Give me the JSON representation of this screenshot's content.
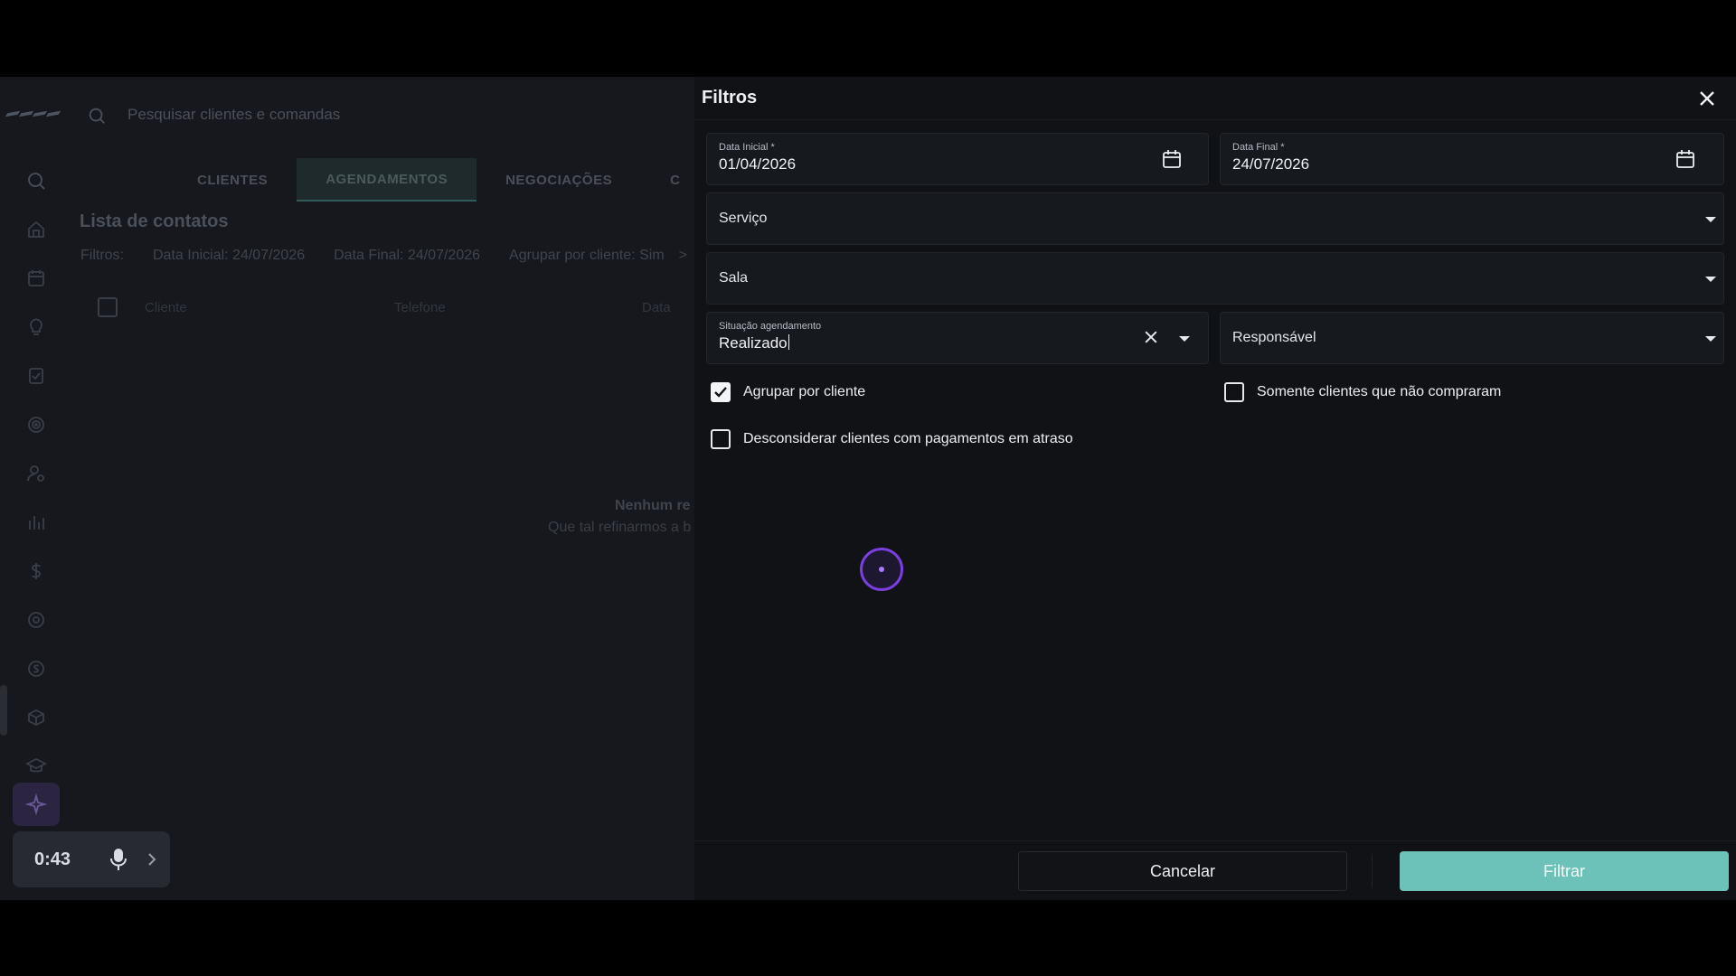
{
  "app": {
    "search_placeholder": "Pesquisar clientes e comandas",
    "tabs": [
      {
        "label": "CLIENTES"
      },
      {
        "label": "AGENDAMENTOS"
      },
      {
        "label": "NEGOCIAÇÕES"
      },
      {
        "label": "C"
      }
    ],
    "list_title": "Lista de contatos",
    "filters": {
      "label": "Filtros:",
      "chips": [
        "Data Inicial: 24/07/2026",
        "Data Final: 24/07/2026",
        "Agrupar por cliente: Sim"
      ],
      "more": ">"
    },
    "table_headers": [
      "Cliente",
      "Telefone",
      "Data"
    ],
    "empty_title": "Nenhum re",
    "empty_subtitle": "Que tal refinarmos a b",
    "recorder": {
      "time": "0:43"
    }
  },
  "modal": {
    "title": "Filtros",
    "data_inicial": {
      "label": "Data Inicial *",
      "value": "01/04/2026"
    },
    "data_final": {
      "label": "Data Final *",
      "value": "24/07/2026"
    },
    "servico": {
      "placeholder": "Serviço"
    },
    "sala": {
      "placeholder": "Sala"
    },
    "situacao": {
      "label": "Situação agendamento",
      "value": "Realizado"
    },
    "responsavel": {
      "placeholder": "Responsável"
    },
    "agrupar_por_cliente": {
      "label": "Agrupar por cliente",
      "checked": true
    },
    "somente_clientes": {
      "label": "Somente clientes que não compraram",
      "checked": false
    },
    "desconsiderar": {
      "label": "Desconsiderar clientes com pagamentos em atraso",
      "checked": false
    },
    "cancel_label": "Cancelar",
    "filter_label": "Filtrar"
  },
  "colors": {
    "accent": "#6cc2b8",
    "loader": "#7a3fe0",
    "background": "#16181d",
    "modal_background": "#101216"
  }
}
